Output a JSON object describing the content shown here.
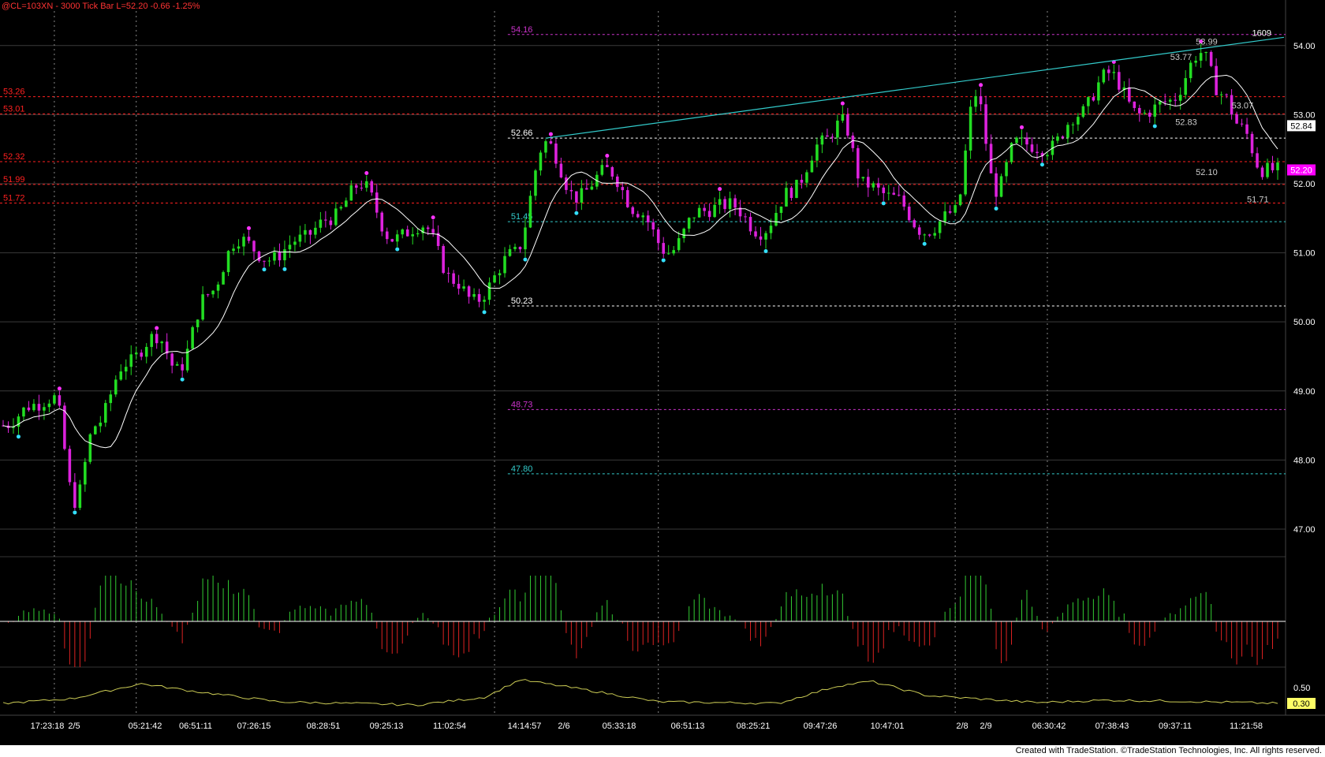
{
  "window": {
    "title": "@CL=103XN - 3000 Tick Bar",
    "last_label": "L=52.20",
    "change": "-0.66",
    "change_pct": "-1.25%"
  },
  "footer": {
    "copyright": "Created with TradeStation. ©TradeStation Technologies, Inc. All rights reserved."
  },
  "colors": {
    "background": "#000000",
    "grid": "#3a3a3a",
    "up": "#22dd22",
    "down": "#dd22dd",
    "ma": "#ffffff",
    "trendline": "#33cccc",
    "red_level": "#ff2020",
    "magenta_level": "#cc33cc",
    "white_level": "#ffffff",
    "cyan_level": "#33cccc",
    "hist_up": "#33cc33",
    "hist_down": "#dd2222",
    "osc": "#cccc55",
    "swing_high": "#ff33ff",
    "swing_low": "#33e0ff"
  },
  "chart_data": {
    "type": "candlestick",
    "ylim": [
      46.6,
      54.5
    ],
    "yticks": [
      "54.00",
      "53.00",
      "52.00",
      "51.00",
      "50.00",
      "49.00",
      "48.00",
      "47.00"
    ],
    "last_price": "52.84",
    "last_close_badge": "52.20",
    "x_tick_labels": [
      "17:23:18",
      "2/5",
      "05:21:42",
      "06:51:11",
      "07:26:15",
      "08:28:51",
      "09:25:13",
      "11:02:54",
      "14:14:57",
      "2/6",
      "05:33:18",
      "06:51:13",
      "08:25:21",
      "09:47:26",
      "10:47:01",
      "2/8",
      "2/9",
      "06:30:42",
      "07:38:43",
      "09:37:11",
      "11:21:58"
    ],
    "price_path": [
      [
        0,
        48.5
      ],
      [
        6,
        48.8
      ],
      [
        10,
        48.9
      ],
      [
        14,
        47.4
      ],
      [
        18,
        48.5
      ],
      [
        24,
        49.4
      ],
      [
        30,
        49.8
      ],
      [
        34,
        49.3
      ],
      [
        40,
        50.4
      ],
      [
        46,
        51.2
      ],
      [
        52,
        50.9
      ],
      [
        58,
        51.2
      ],
      [
        64,
        51.5
      ],
      [
        70,
        52.0
      ],
      [
        76,
        51.2
      ],
      [
        82,
        51.4
      ],
      [
        88,
        50.6
      ],
      [
        92,
        50.3
      ],
      [
        100,
        51.0
      ],
      [
        106,
        52.6
      ],
      [
        112,
        51.8
      ],
      [
        118,
        52.2
      ],
      [
        124,
        51.6
      ],
      [
        130,
        51.0
      ],
      [
        136,
        51.6
      ],
      [
        142,
        51.7
      ],
      [
        148,
        51.3
      ],
      [
        154,
        51.9
      ],
      [
        160,
        52.6
      ],
      [
        164,
        52.9
      ],
      [
        168,
        52.0
      ],
      [
        174,
        51.8
      ],
      [
        180,
        51.3
      ],
      [
        186,
        51.6
      ],
      [
        190,
        53.3
      ],
      [
        194,
        51.9
      ],
      [
        198,
        52.6
      ],
      [
        204,
        52.5
      ],
      [
        210,
        53.0
      ],
      [
        216,
        53.6
      ],
      [
        222,
        53.0
      ],
      [
        228,
        53.2
      ],
      [
        234,
        53.9
      ],
      [
        238,
        53.3
      ],
      [
        242,
        52.8
      ],
      [
        246,
        52.2
      ]
    ],
    "levels": [
      {
        "label": "54.16",
        "price": 54.16,
        "color": "magenta",
        "start": 0.395
      },
      {
        "label": "53.26",
        "price": 53.26,
        "color": "red",
        "start": 0
      },
      {
        "label": "53.01",
        "price": 53.01,
        "color": "red",
        "start": 0
      },
      {
        "label": "52.66",
        "price": 52.66,
        "color": "white",
        "start": 0.395
      },
      {
        "label": "52.32",
        "price": 52.32,
        "color": "red",
        "start": 0
      },
      {
        "label": "51.99",
        "price": 51.99,
        "color": "red",
        "start": 0
      },
      {
        "label": "51.72",
        "price": 51.72,
        "color": "red",
        "start": 0
      },
      {
        "label": "51.45",
        "price": 51.45,
        "color": "cyan",
        "start": 0.395
      },
      {
        "label": "50.23",
        "price": 50.23,
        "color": "white",
        "start": 0.395
      },
      {
        "label": "48.73",
        "price": 48.73,
        "color": "magenta",
        "start": 0.395
      },
      {
        "label": "47.80",
        "price": 47.8,
        "color": "cyan",
        "start": 0.395
      }
    ],
    "annotations": [
      {
        "label": "53.99",
        "price": 53.99
      },
      {
        "label": "53.77",
        "price": 53.77
      },
      {
        "label": "53.07",
        "price": 53.07
      },
      {
        "label": "52.83",
        "price": 52.83
      },
      {
        "label": "52.10",
        "price": 52.1
      },
      {
        "label": "51.71",
        "price": 51.71
      },
      {
        "label": "1609",
        "price": 54.12
      }
    ],
    "oscillator": {
      "yticks": [
        "0.50",
        "0.30"
      ],
      "last_badge": "0.30"
    }
  }
}
